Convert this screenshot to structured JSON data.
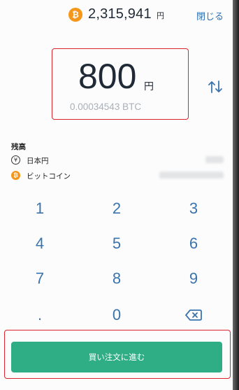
{
  "header": {
    "btc_icon_glyph": "₿",
    "price": "2,315,941",
    "price_unit": "円",
    "close_label": "閉じる"
  },
  "amount": {
    "value": "800",
    "unit": "円",
    "btc_equivalent": "0.00034543 BTC"
  },
  "balance": {
    "title": "残高",
    "rows": [
      {
        "icon": "yen-icon",
        "icon_glyph": "¥",
        "label": "日本円"
      },
      {
        "icon": "btc-icon",
        "icon_glyph": "₿",
        "label": "ビットコイン"
      }
    ]
  },
  "keypad": {
    "keys": [
      "1",
      "2",
      "3",
      "4",
      "5",
      "6",
      "7",
      "8",
      "9",
      ".",
      "0"
    ],
    "backspace_icon": "backspace-icon"
  },
  "order_button_label": "買い注文に進む",
  "colors": {
    "accent_blue": "#3b74ad",
    "buy_green": "#2fae85",
    "bitcoin_orange": "#f4971b",
    "highlight_red": "#d9242b"
  }
}
